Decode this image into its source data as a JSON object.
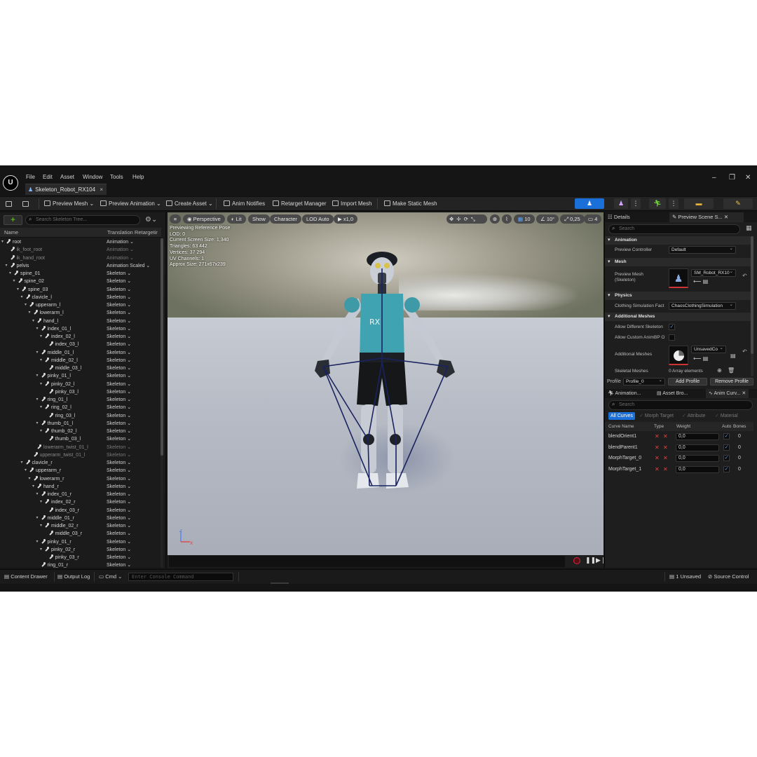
{
  "menu": [
    "File",
    "Edit",
    "Asset",
    "Window",
    "Tools",
    "Help"
  ],
  "logo_text": "U",
  "document_tab": {
    "label": "Skeleton_Robot_RX104",
    "close": "×"
  },
  "window_controls": {
    "minimize": "–",
    "restore": "❐",
    "close": "✕"
  },
  "toolbar": {
    "preview_mesh": "Preview Mesh",
    "preview_animation": "Preview Animation",
    "create_asset": "Create Asset",
    "anim_notifies": "Anim Notifies",
    "retarget_manager": "Retarget Manager",
    "import_mesh": "Import Mesh",
    "make_static_mesh": "Make Static Mesh",
    "active_mode_color": "#1a6fd8"
  },
  "skeleton_tree": {
    "search_placeholder": "Search Skeleton Tree...",
    "col_name": "Name",
    "col_translation": "Translation Retargetir",
    "add_label": "+",
    "rows": [
      {
        "name": "root",
        "type": "Animation",
        "depth": 0
      },
      {
        "name": "ik_foot_root",
        "type": "Animation",
        "depth": 1,
        "dim": true
      },
      {
        "name": "ik_hand_root",
        "type": "Animation",
        "depth": 1,
        "dim": true
      },
      {
        "name": "pelvis",
        "type": "Animation Scaled",
        "depth": 1
      },
      {
        "name": "spine_01",
        "type": "Skeleton",
        "depth": 2
      },
      {
        "name": "spine_02",
        "type": "Skeleton",
        "depth": 3
      },
      {
        "name": "spine_03",
        "type": "Skeleton",
        "depth": 4
      },
      {
        "name": "clavicle_l",
        "type": "Skeleton",
        "depth": 5
      },
      {
        "name": "upperarm_l",
        "type": "Skeleton",
        "depth": 6
      },
      {
        "name": "lowerarm_l",
        "type": "Skeleton",
        "depth": 7
      },
      {
        "name": "hand_l",
        "type": "Skeleton",
        "depth": 8
      },
      {
        "name": "index_01_l",
        "type": "Skeleton",
        "depth": 9
      },
      {
        "name": "index_02_l",
        "type": "Skeleton",
        "depth": 10
      },
      {
        "name": "index_03_l",
        "type": "Skeleton",
        "depth": 11
      },
      {
        "name": "middle_01_l",
        "type": "Skeleton",
        "depth": 9
      },
      {
        "name": "middle_02_l",
        "type": "Skeleton",
        "depth": 10
      },
      {
        "name": "middle_03_l",
        "type": "Skeleton",
        "depth": 11
      },
      {
        "name": "pinky_01_l",
        "type": "Skeleton",
        "depth": 9
      },
      {
        "name": "pinky_02_l",
        "type": "Skeleton",
        "depth": 10
      },
      {
        "name": "pinky_03_l",
        "type": "Skeleton",
        "depth": 11
      },
      {
        "name": "ring_01_l",
        "type": "Skeleton",
        "depth": 9
      },
      {
        "name": "ring_02_l",
        "type": "Skeleton",
        "depth": 10
      },
      {
        "name": "ring_03_l",
        "type": "Skeleton",
        "depth": 11
      },
      {
        "name": "thumb_01_l",
        "type": "Skeleton",
        "depth": 9
      },
      {
        "name": "thumb_02_l",
        "type": "Skeleton",
        "depth": 10
      },
      {
        "name": "thumb_03_l",
        "type": "Skeleton",
        "depth": 11
      },
      {
        "name": "lowerarm_twist_01_l",
        "type": "Skeleton",
        "depth": 8,
        "dim": true
      },
      {
        "name": "upperarm_twist_01_l",
        "type": "Skeleton",
        "depth": 7,
        "dim": true
      },
      {
        "name": "clavicle_r",
        "type": "Skeleton",
        "depth": 5
      },
      {
        "name": "upperarm_r",
        "type": "Skeleton",
        "depth": 6
      },
      {
        "name": "lowerarm_r",
        "type": "Skeleton",
        "depth": 7
      },
      {
        "name": "hand_r",
        "type": "Skeleton",
        "depth": 8
      },
      {
        "name": "index_01_r",
        "type": "Skeleton",
        "depth": 9
      },
      {
        "name": "index_02_r",
        "type": "Skeleton",
        "depth": 10
      },
      {
        "name": "index_03_r",
        "type": "Skeleton",
        "depth": 11
      },
      {
        "name": "middle_01_r",
        "type": "Skeleton",
        "depth": 9
      },
      {
        "name": "middle_02_r",
        "type": "Skeleton",
        "depth": 10
      },
      {
        "name": "middle_03_r",
        "type": "Skeleton",
        "depth": 11
      },
      {
        "name": "pinky_01_r",
        "type": "Skeleton",
        "depth": 9
      },
      {
        "name": "pinky_02_r",
        "type": "Skeleton",
        "depth": 10
      },
      {
        "name": "pinky_03_r",
        "type": "Skeleton",
        "depth": 11
      },
      {
        "name": "ring_01_r",
        "type": "Skeleton",
        "depth": 9
      }
    ]
  },
  "viewport": {
    "perspective": "Perspective",
    "lit": "Lit",
    "show": "Show",
    "character": "Character",
    "lod": "LOD Auto",
    "play_rate": "x1,0",
    "grid_size": "10",
    "rotation_snap": "10°",
    "scale_snap": "0,25",
    "camera_speed": "4",
    "stats": [
      "Previewing Reference Pose",
      "LOD: 0",
      "Current Screen Size: 1,340",
      "Triangles: 63 442",
      "Vertices: 37 294",
      "UV Channels: 1",
      "Approx Size: 271x67x239"
    ],
    "axis_x": "X",
    "axis_z": "Z"
  },
  "details": {
    "tab_details": "Details",
    "tab_preview": "Preview Scene S...",
    "search_placeholder": "Search",
    "section_animation": "Animation",
    "preview_controller_label": "Preview Controller",
    "preview_controller_value": "Default",
    "section_mesh": "Mesh",
    "preview_mesh_label": "Preview Mesh",
    "preview_mesh_sub": "(Skeleton)",
    "preview_mesh_value": "SM_Robot_RX10",
    "section_physics": "Physics",
    "clothing_label": "Clothing Simulation Fact",
    "clothing_value": "ChaosClothingSimulation",
    "section_additional": "Additional Meshes",
    "allow_different_label": "Allow Different Skeleton",
    "allow_custom_label": "Allow Custom AnimBP O",
    "additional_meshes_label": "Additional Meshes",
    "additional_meshes_value": "UnsavedCo",
    "skeletal_meshes_label": "Skeletal Meshes",
    "array_elements": "0 Array elements",
    "profile_label": "Profile",
    "profile_value": "Profile_0",
    "add_profile": "Add Profile",
    "remove_profile": "Remove Profile"
  },
  "curves": {
    "tab_animation": "Animation...",
    "tab_asset_browser": "Asset Bro...",
    "tab_anim_curves": "Anim Curv...",
    "search_placeholder": "Search",
    "filter_all": "All Curves",
    "filter_morph": "Morph Target",
    "filter_attribute": "Attribute",
    "filter_material": "Material",
    "col_name": "Curve Name",
    "col_type": "Type",
    "col_weight": "Weight",
    "col_auto": "Auto",
    "col_bones": "Bones",
    "rows": [
      {
        "name": "blendOrient1",
        "weight": "0,0",
        "bones": "0"
      },
      {
        "name": "blendParent1",
        "weight": "0,0",
        "bones": "0"
      },
      {
        "name": "MorphTarget_0",
        "weight": "0,0",
        "bones": "0"
      },
      {
        "name": "MorphTarget_1",
        "weight": "0,0",
        "bones": "0"
      }
    ]
  },
  "statusbar": {
    "content_drawer": "Content Drawer",
    "output_log": "Output Log",
    "cmd": "Cmd",
    "console_placeholder": "Enter Console Command",
    "unsaved": "1 Unsaved",
    "source_control": "Source Control"
  }
}
